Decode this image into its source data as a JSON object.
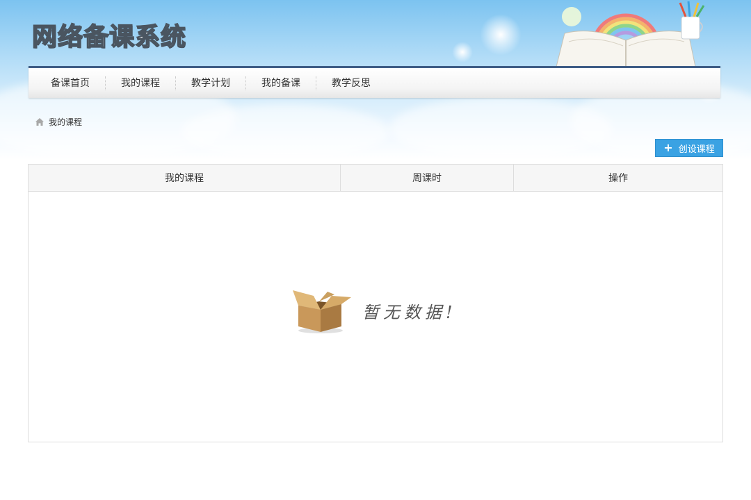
{
  "app": {
    "title": "网络备课系统"
  },
  "nav": {
    "items": [
      {
        "label": "备课首页"
      },
      {
        "label": "我的课程"
      },
      {
        "label": "教学计划"
      },
      {
        "label": "我的备课"
      },
      {
        "label": "教学反思"
      }
    ]
  },
  "breadcrumb": {
    "current": "我的课程"
  },
  "actions": {
    "create_label": "创设课程"
  },
  "table": {
    "columns": [
      "我的课程",
      "周课时",
      "操作"
    ],
    "rows": [],
    "empty_text": "暂无数据!"
  },
  "colors": {
    "nav_accent": "#3f5d86",
    "button_bg": "#3aa2e3",
    "header_bg": "#f6f6f6"
  }
}
